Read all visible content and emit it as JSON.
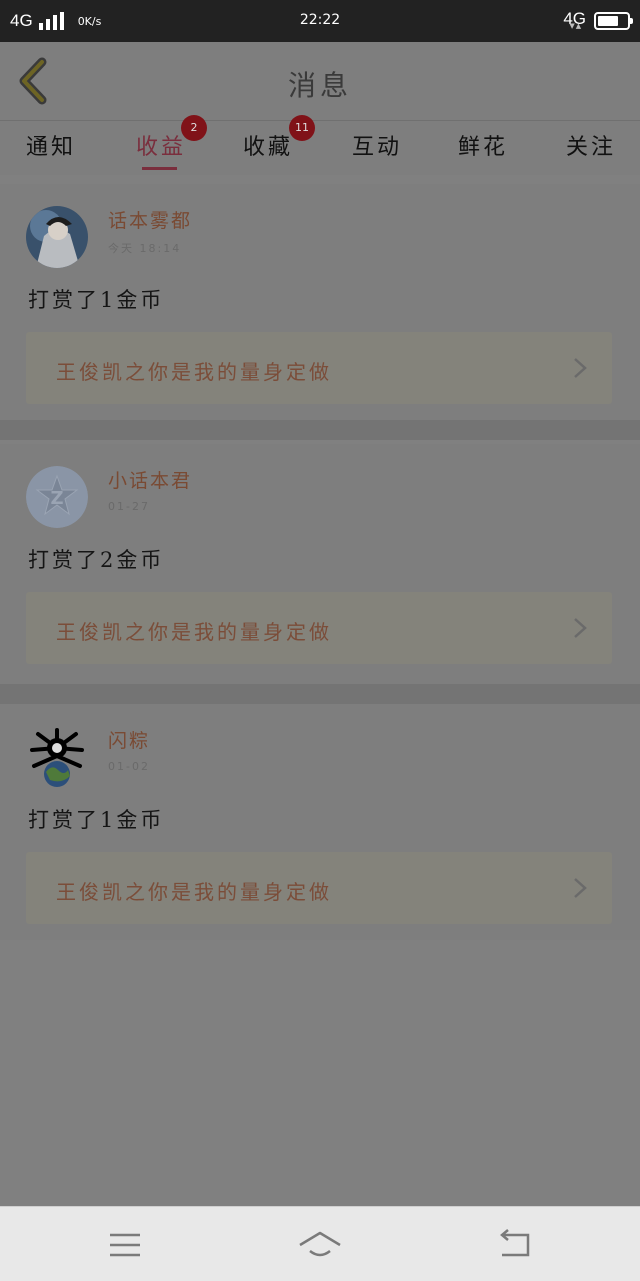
{
  "status_bar": {
    "network_left": "4G",
    "speed": "0K/s",
    "time": "22:22",
    "network_right": "4G"
  },
  "header": {
    "title": "消息",
    "back_icon": "chevron-left-icon"
  },
  "tabs": [
    {
      "label": "通知",
      "active": false
    },
    {
      "label": "收益",
      "active": true,
      "badge": "2"
    },
    {
      "label": "收藏",
      "active": false,
      "badge": "11"
    },
    {
      "label": "互动",
      "active": false
    },
    {
      "label": "鲜花",
      "active": false
    },
    {
      "label": "关注",
      "active": false
    }
  ],
  "messages": [
    {
      "username": "话本雾都",
      "time": "今天 18:14",
      "text": "打赏了1金币",
      "item_title": "王俊凯之你是我的量身定做"
    },
    {
      "username": "小话本君",
      "time": "01-27",
      "text": "打赏了2金币",
      "item_title": "王俊凯之你是我的量身定做"
    },
    {
      "username": "闪粽",
      "time": "01-02",
      "text": "打赏了1金币",
      "item_title": "王俊凯之你是我的量身定做"
    }
  ],
  "nav_bar": {
    "menu_icon": "menu-icon",
    "home_icon": "home-icon",
    "back_icon": "back-icon"
  },
  "colors": {
    "status_bar": "#222222",
    "overlay_bg": "#808080",
    "accent": "#7a2e3d",
    "badge": "#801218",
    "nav_bar": "#e8e8e8"
  }
}
